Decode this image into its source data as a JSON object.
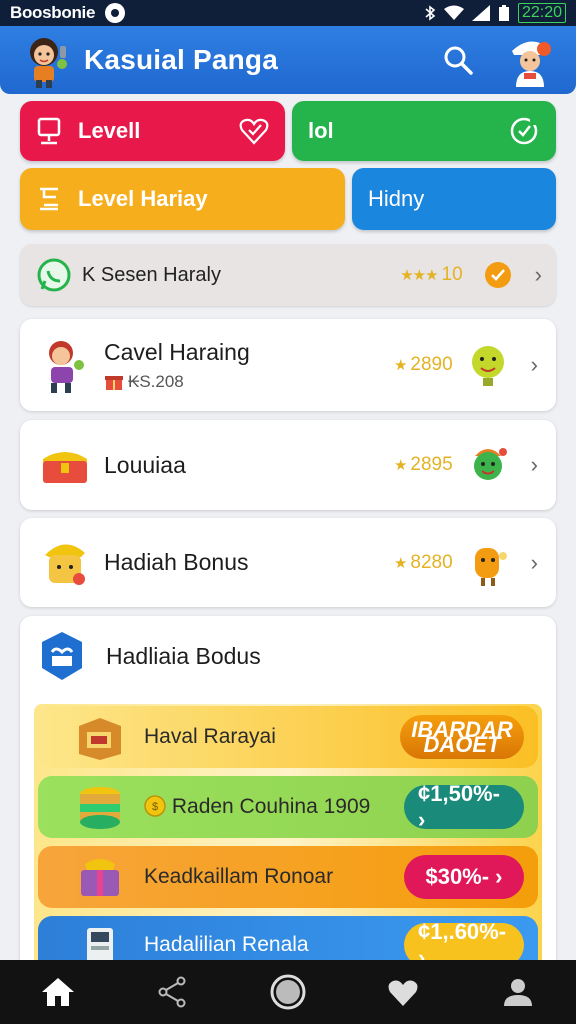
{
  "status_bar": {
    "carrier": "Boosbonie",
    "time": "22:20"
  },
  "header": {
    "title": "Kasuial Panga"
  },
  "tiles": {
    "level": "Levell",
    "lol": "lol",
    "level_hariay": "Level Hariay",
    "hidny": "Hidny"
  },
  "promo": {
    "label": "K Sesen Haraly",
    "stars": "★★★",
    "score": "10"
  },
  "cards": [
    {
      "title": "Cavel Haraing",
      "sub": "₭S.208",
      "stars": "★",
      "score": "2890"
    },
    {
      "title": "Louuiaa",
      "stars": "★",
      "score": "2895"
    },
    {
      "title": "Hadiah Bonus",
      "stars": "★",
      "score": "8280"
    }
  ],
  "bonus": {
    "title": "Hadliaia Bodus",
    "offers": [
      {
        "label": "Haval Rarayai",
        "pill": "IBARDAR DAOET"
      },
      {
        "label": "Raden Couhina 1909",
        "pill": "¢1,50%- ›"
      },
      {
        "label": "Keadkaillam Ronoar",
        "pill": "$30%- ›"
      },
      {
        "label": "Hadalilian Renala",
        "pill": "¢1,.60%- ›"
      }
    ]
  },
  "colors": {
    "header": "#1f68cf",
    "red": "#e8194a",
    "green": "#25b44c",
    "orange": "#f6ae1d",
    "blue": "#1a86dd"
  }
}
